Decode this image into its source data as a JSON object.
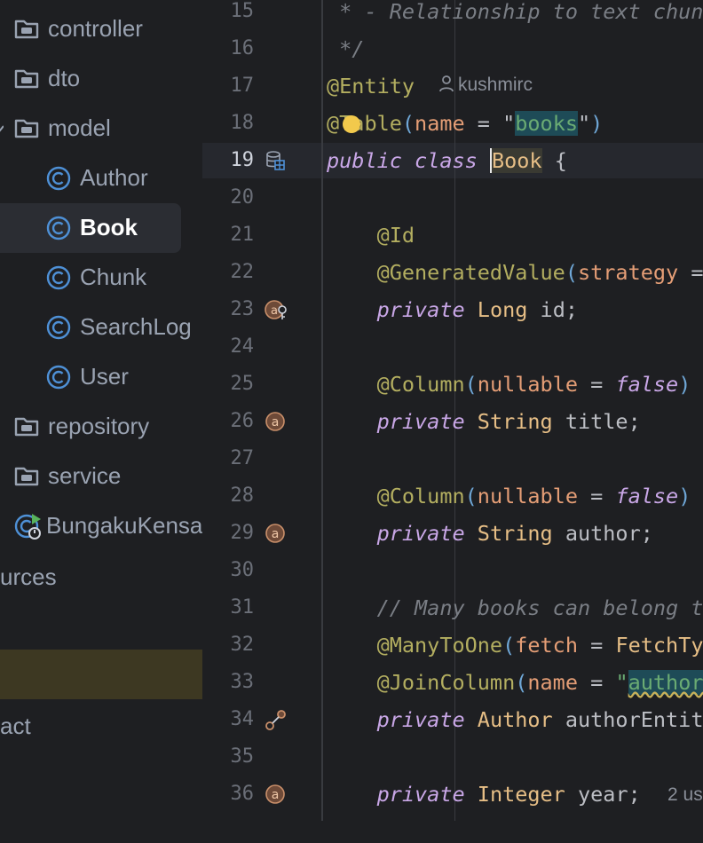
{
  "project_tree": {
    "items": [
      {
        "id": "controller",
        "label": "controller",
        "icon": "folder-icon",
        "selected": false
      },
      {
        "id": "dto",
        "label": "dto",
        "icon": "folder-icon",
        "selected": false
      },
      {
        "id": "model",
        "label": "model",
        "icon": "folder-icon",
        "selected": false
      },
      {
        "id": "author",
        "label": "Author",
        "icon": "class-icon",
        "selected": false
      },
      {
        "id": "book",
        "label": "Book",
        "icon": "class-icon",
        "selected": true
      },
      {
        "id": "chunk",
        "label": "Chunk",
        "icon": "class-icon",
        "selected": false
      },
      {
        "id": "searchlog",
        "label": "SearchLog",
        "icon": "class-icon",
        "selected": false
      },
      {
        "id": "user",
        "label": "User",
        "icon": "class-icon",
        "selected": false
      },
      {
        "id": "repository",
        "label": "repository",
        "icon": "folder-icon",
        "selected": false
      },
      {
        "id": "service",
        "label": "service",
        "icon": "folder-icon",
        "selected": false
      },
      {
        "id": "app",
        "label": "BungakuKensa",
        "icon": "spring-boot-app-icon",
        "selected": false
      }
    ],
    "resources_label": "urces",
    "act_label": "act"
  },
  "editor": {
    "lines": [
      {
        "n": "15",
        "text": " * - Relationship to text chun"
      },
      {
        "n": "16",
        "text": " */"
      },
      {
        "n": "17",
        "text": "@Entity",
        "author_hint": "kushmirc"
      },
      {
        "n": "18",
        "text": "@Table(name = \"books\")"
      },
      {
        "n": "19",
        "text": "public class Book {"
      },
      {
        "n": "20",
        "text": ""
      },
      {
        "n": "21",
        "text": "    @Id"
      },
      {
        "n": "22",
        "text": "    @GeneratedValue(strategy ="
      },
      {
        "n": "23",
        "text": "    private Long id;"
      },
      {
        "n": "24",
        "text": ""
      },
      {
        "n": "25",
        "text": "    @Column(nullable = false)"
      },
      {
        "n": "26",
        "text": "    private String title;"
      },
      {
        "n": "27",
        "text": ""
      },
      {
        "n": "28",
        "text": "    @Column(nullable = false)"
      },
      {
        "n": "29",
        "text": "    private String author;"
      },
      {
        "n": "30",
        "text": ""
      },
      {
        "n": "31",
        "text": "    // Many books can belong t"
      },
      {
        "n": "32",
        "text": "    @ManyToOne(fetch = FetchTy"
      },
      {
        "n": "33",
        "text": "    @JoinColumn(name = \"author"
      },
      {
        "n": "34",
        "text": "    private Author authorEntit"
      },
      {
        "n": "35",
        "text": ""
      },
      {
        "n": "36",
        "text": "    private Integer year;",
        "usage_hint": "2 us"
      }
    ],
    "current_line": "19"
  },
  "colors": {
    "background": "#1e1f22",
    "keyword": "#c9a7e7",
    "annotation": "#b3ae60",
    "string": "#6aab73",
    "type": "#e6be86",
    "comment": "#7a7e85",
    "param": "#e59e76"
  }
}
